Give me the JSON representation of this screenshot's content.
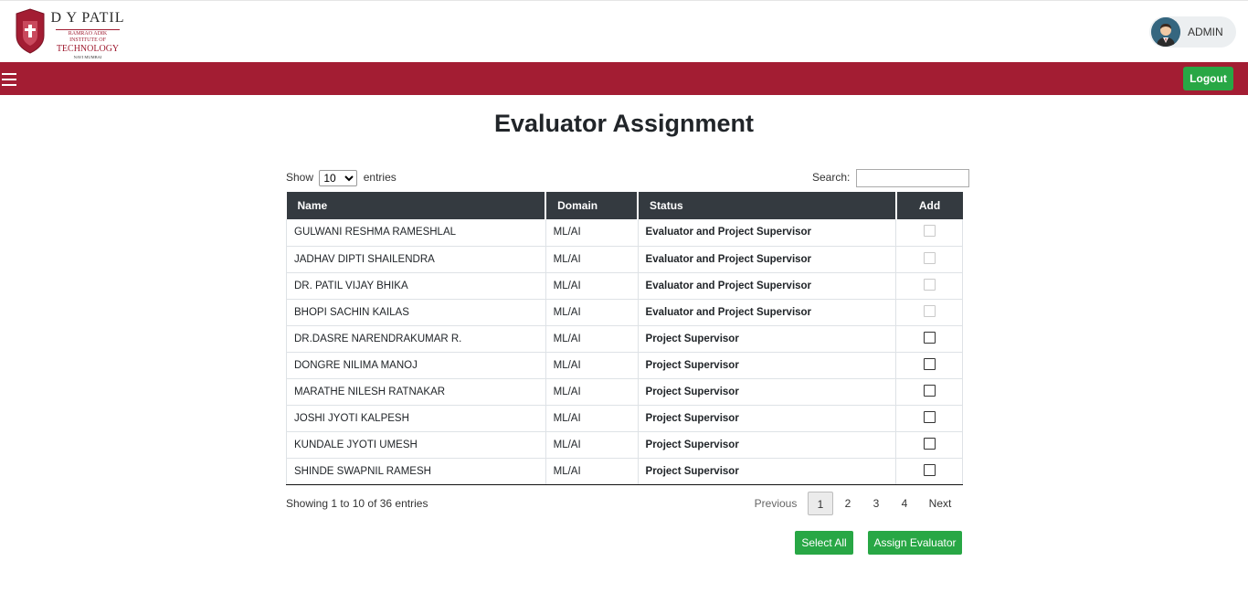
{
  "header": {
    "logo_lines": [
      "D Y PATIL",
      "RAMRAO ADIK",
      "INSTITUTE OF",
      "TECHNOLOGY",
      "NAVI MUMBAI"
    ],
    "user_label": "ADMIN"
  },
  "navbar": {
    "logout_label": "Logout",
    "color": "#a31d33"
  },
  "page_title": "Evaluator Assignment",
  "controls": {
    "show_label": "Show",
    "entries_label": "entries",
    "page_length": "10",
    "search_label": "Search:",
    "search_value": ""
  },
  "table": {
    "columns": [
      "Name",
      "Domain",
      "Status",
      "Add"
    ],
    "rows": [
      {
        "name": "GULWANI RESHMA RAMESHLAL",
        "domain": "ML/AI",
        "status": "Evaluator and Project Supervisor",
        "checkbox_enabled": false
      },
      {
        "name": "JADHAV DIPTI SHAILENDRA",
        "domain": "ML/AI",
        "status": "Evaluator and Project Supervisor",
        "checkbox_enabled": false
      },
      {
        "name": "DR. PATIL VIJAY BHIKA",
        "domain": "ML/AI",
        "status": "Evaluator and Project Supervisor",
        "checkbox_enabled": false
      },
      {
        "name": "BHOPI SACHIN KAILAS",
        "domain": "ML/AI",
        "status": "Evaluator and Project Supervisor",
        "checkbox_enabled": false
      },
      {
        "name": "DR.DASRE NARENDRAKUMAR R.",
        "domain": "ML/AI",
        "status": "Project Supervisor",
        "checkbox_enabled": true
      },
      {
        "name": "DONGRE NILIMA MANOJ",
        "domain": "ML/AI",
        "status": "Project Supervisor",
        "checkbox_enabled": true
      },
      {
        "name": "MARATHE NILESH RATNAKAR",
        "domain": "ML/AI",
        "status": "Project Supervisor",
        "checkbox_enabled": true
      },
      {
        "name": "JOSHI JYOTI KALPESH",
        "domain": "ML/AI",
        "status": "Project Supervisor",
        "checkbox_enabled": true
      },
      {
        "name": "KUNDALE JYOTI UMESH",
        "domain": "ML/AI",
        "status": "Project Supervisor",
        "checkbox_enabled": true
      },
      {
        "name": "SHINDE SWAPNIL RAMESH",
        "domain": "ML/AI",
        "status": "Project Supervisor",
        "checkbox_enabled": true
      }
    ]
  },
  "footer": {
    "info_text": "Showing 1 to 10 of 36 entries",
    "pagination": {
      "previous": "Previous",
      "pages": [
        "1",
        "2",
        "3",
        "4"
      ],
      "current": "1",
      "next": "Next"
    },
    "select_all_label": "Select All",
    "assign_label": "Assign Evaluator"
  }
}
